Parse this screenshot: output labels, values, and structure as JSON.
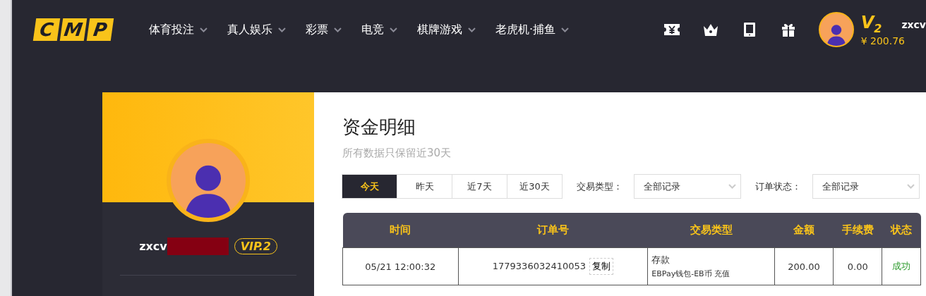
{
  "header": {
    "logo": [
      "C",
      "M",
      "P"
    ],
    "nav": [
      {
        "label": "体育投注"
      },
      {
        "label": "真人娱乐"
      },
      {
        "label": "彩票"
      },
      {
        "label": "电竞"
      },
      {
        "label": "棋牌游戏"
      },
      {
        "label": "老虎机·捕鱼"
      }
    ],
    "user": {
      "level": "V$_{2}$",
      "balance": "¥ 200.76",
      "username": "zxcv"
    }
  },
  "profile": {
    "username": "zxcv",
    "vip": "VIP.2"
  },
  "page": {
    "title": "资金明细",
    "subtitle": "所有数据只保留近30天",
    "ranges": [
      {
        "label": "今天",
        "selected": true
      },
      {
        "label": "昨天",
        "selected": false
      },
      {
        "label": "近7天",
        "selected": false
      },
      {
        "label": "近30天",
        "selected": false
      }
    ],
    "filters": [
      {
        "label": "交易类型：",
        "value": "全部记录"
      },
      {
        "label": "订单状态：",
        "value": "全部记录"
      }
    ],
    "table": {
      "columns": [
        "时间",
        "订单号",
        "交易类型",
        "金额",
        "手续费",
        "状态"
      ],
      "rows": [
        {
          "time": "05/21 12:00:32",
          "order": "1779336032410053",
          "copy": "复制",
          "type": "存款",
          "type_detail": "EBPay钱包-EB币 充值",
          "amount": "200.00",
          "fee": "0.00",
          "status": {
            "text": "成功",
            "kind": "success"
          }
        }
      ]
    }
  }
}
